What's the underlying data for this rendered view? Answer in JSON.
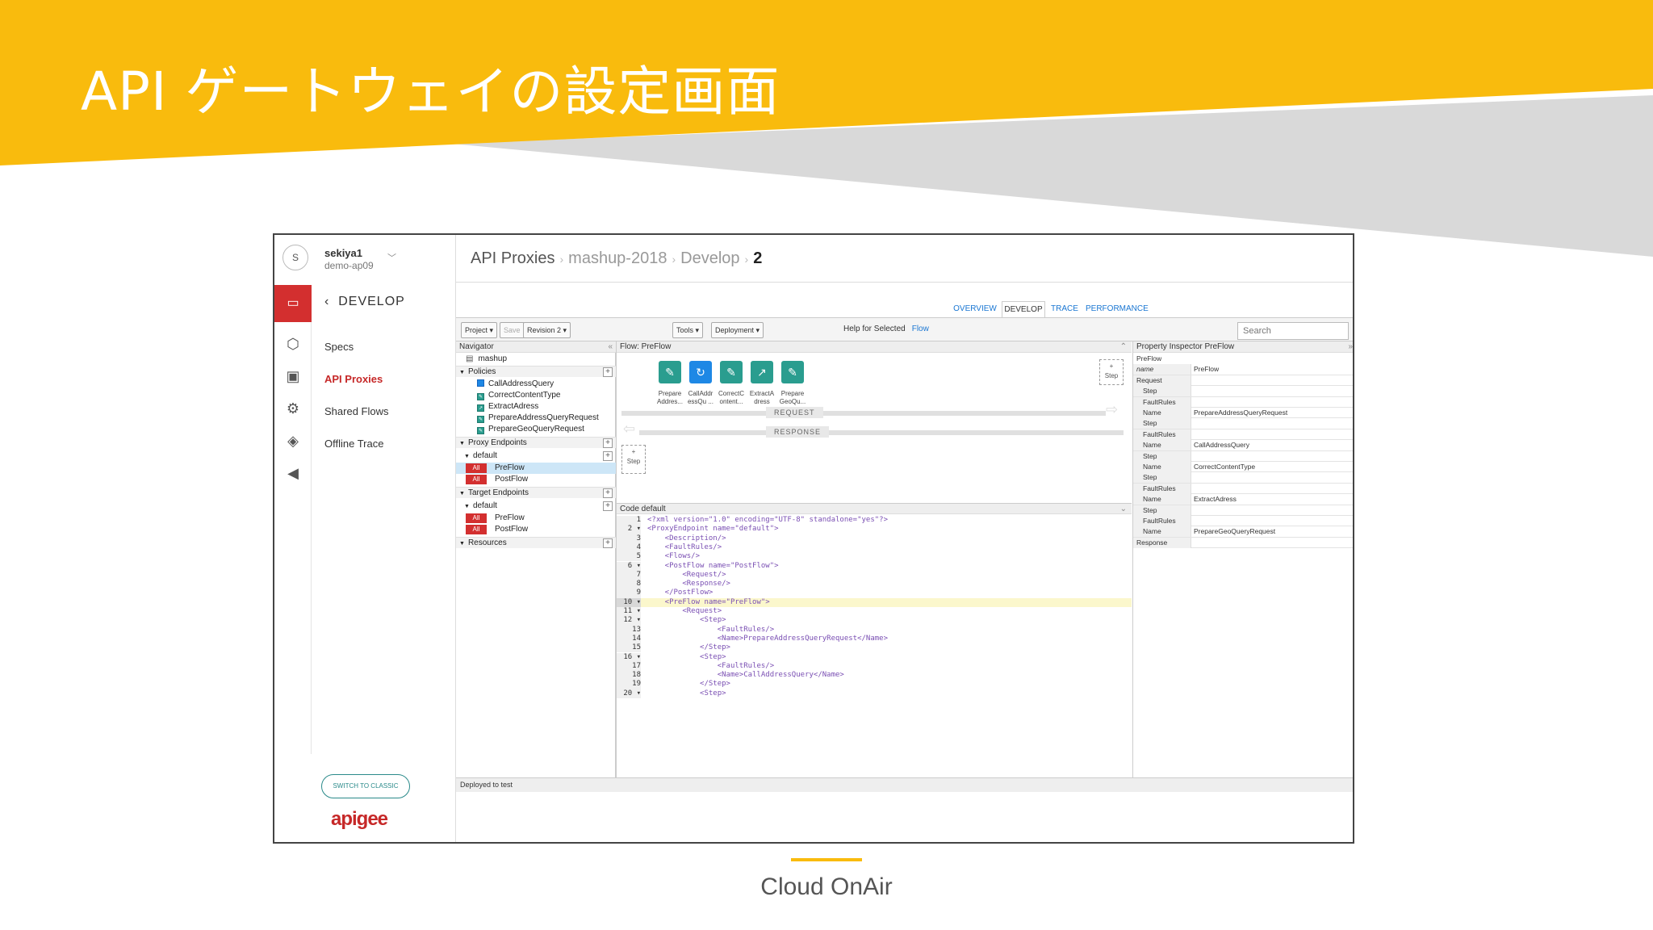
{
  "slide": {
    "title": "API ゲートウェイの設定画面",
    "footer": "Cloud OnAir"
  },
  "user": {
    "avatar": "S",
    "name": "sekiya1",
    "org": "demo-ap09"
  },
  "sidebar": {
    "section": "DEVELOP",
    "items": [
      {
        "label": "Specs",
        "icon": "cube-icon"
      },
      {
        "label": "API Proxies",
        "icon": "monitor-icon"
      },
      {
        "label": "Shared Flows",
        "icon": "gears-icon"
      },
      {
        "label": "Offline Trace",
        "icon": "graduation-cap-icon"
      },
      {
        "label": "",
        "icon": "megaphone-icon"
      }
    ],
    "switch_label": "SWITCH TO CLASSIC",
    "logo": "apigee"
  },
  "breadcrumb": [
    "API Proxies",
    "mashup-2018",
    "Develop",
    "2"
  ],
  "tabs": [
    "OVERVIEW",
    "DEVELOP",
    "TRACE",
    "PERFORMANCE"
  ],
  "toolbar": {
    "project": "Project ▾",
    "save": "Save",
    "revision": "Revision 2 ▾",
    "tools": "Tools ▾",
    "deployment": "Deployment ▾",
    "help_label": "Help for Selected",
    "help_link": "Flow",
    "search_placeholder": "Search"
  },
  "navigator": {
    "title": "Navigator",
    "root": "mashup",
    "policies_label": "Policies",
    "policies": [
      "CallAddressQuery",
      "CorrectContentType",
      "ExtractAdress",
      "PrepareAddressQueryRequest",
      "PrepareGeoQueryRequest"
    ],
    "proxy_endpoints_label": "Proxy Endpoints",
    "target_endpoints_label": "Target Endpoints",
    "default_label": "default",
    "all_badge": "All",
    "preflow": "PreFlow",
    "postflow": "PostFlow",
    "resources_label": "Resources"
  },
  "flow": {
    "title": "Flow: PreFlow",
    "steps": [
      {
        "l1": "Prepare",
        "l2": "Addres..."
      },
      {
        "l1": "CallAddr",
        "l2": "essQu ..."
      },
      {
        "l1": "CorrectC",
        "l2": "ontent..."
      },
      {
        "l1": "ExtractA",
        "l2": "dress"
      },
      {
        "l1": "Prepare",
        "l2": "GeoQu..."
      }
    ],
    "request": "REQUEST",
    "response": "RESPONSE",
    "step_label": "Step"
  },
  "code": {
    "title": "Code default",
    "lines": [
      {
        "n": "1",
        "t": "<?xml version=\"1.0\" encoding=\"UTF-8\" standalone=\"yes\"?>"
      },
      {
        "n": "2 ▾",
        "t": "<ProxyEndpoint name=\"default\">"
      },
      {
        "n": "3",
        "t": "    <Description/>"
      },
      {
        "n": "4",
        "t": "    <FaultRules/>"
      },
      {
        "n": "5",
        "t": "    <Flows/>"
      },
      {
        "n": "6 ▾",
        "t": "    <PostFlow name=\"PostFlow\">"
      },
      {
        "n": "7",
        "t": "        <Request/>"
      },
      {
        "n": "8",
        "t": "        <Response/>"
      },
      {
        "n": "9",
        "t": "    </PostFlow>"
      },
      {
        "n": "10 ▾",
        "t": "    <PreFlow name=\"PreFlow\">"
      },
      {
        "n": "11 ▾",
        "t": "        <Request>"
      },
      {
        "n": "12 ▾",
        "t": "            <Step>"
      },
      {
        "n": "13",
        "t": "                <FaultRules/>"
      },
      {
        "n": "14",
        "t": "                <Name>PrepareAddressQueryRequest</Name>"
      },
      {
        "n": "15",
        "t": "            </Step>"
      },
      {
        "n": "16 ▾",
        "t": "            <Step>"
      },
      {
        "n": "17",
        "t": "                <FaultRules/>"
      },
      {
        "n": "18",
        "t": "                <Name>CallAddressQuery</Name>"
      },
      {
        "n": "19",
        "t": "            </Step>"
      },
      {
        "n": "20 ▾",
        "t": "            <Step>"
      }
    ],
    "highlight_line": 10
  },
  "inspector": {
    "title": "Property Inspector  PreFlow",
    "rows": [
      {
        "k": "PreFlow",
        "v": "",
        "ind": false,
        "hdr": true
      },
      {
        "k": "name",
        "v": "PreFlow",
        "ind": false,
        "it": true
      },
      {
        "k": "Request",
        "v": "",
        "ind": false
      },
      {
        "k": "Step",
        "v": "",
        "ind": true
      },
      {
        "k": "FaultRules",
        "v": "",
        "ind": true
      },
      {
        "k": "Name",
        "v": "PrepareAddressQueryRequest",
        "ind": true
      },
      {
        "k": "Step",
        "v": "",
        "ind": true
      },
      {
        "k": "FaultRules",
        "v": "",
        "ind": true
      },
      {
        "k": "Name",
        "v": "CallAddressQuery",
        "ind": true
      },
      {
        "k": "Step",
        "v": "",
        "ind": true
      },
      {
        "k": "Name",
        "v": "CorrectContentType",
        "ind": true
      },
      {
        "k": "Step",
        "v": "",
        "ind": true
      },
      {
        "k": "FaultRules",
        "v": "",
        "ind": true
      },
      {
        "k": "Name",
        "v": "ExtractAdress",
        "ind": true
      },
      {
        "k": "Step",
        "v": "",
        "ind": true
      },
      {
        "k": "FaultRules",
        "v": "",
        "ind": true
      },
      {
        "k": "Name",
        "v": "PrepareGeoQueryRequest",
        "ind": true
      },
      {
        "k": "Response",
        "v": "",
        "ind": false
      }
    ]
  },
  "status": "Deployed to test",
  "colors": {
    "banner": "#f9bb0d",
    "apigee_red": "#c62828",
    "link": "#1976d2",
    "policy_teal": "#2a9d8f"
  }
}
